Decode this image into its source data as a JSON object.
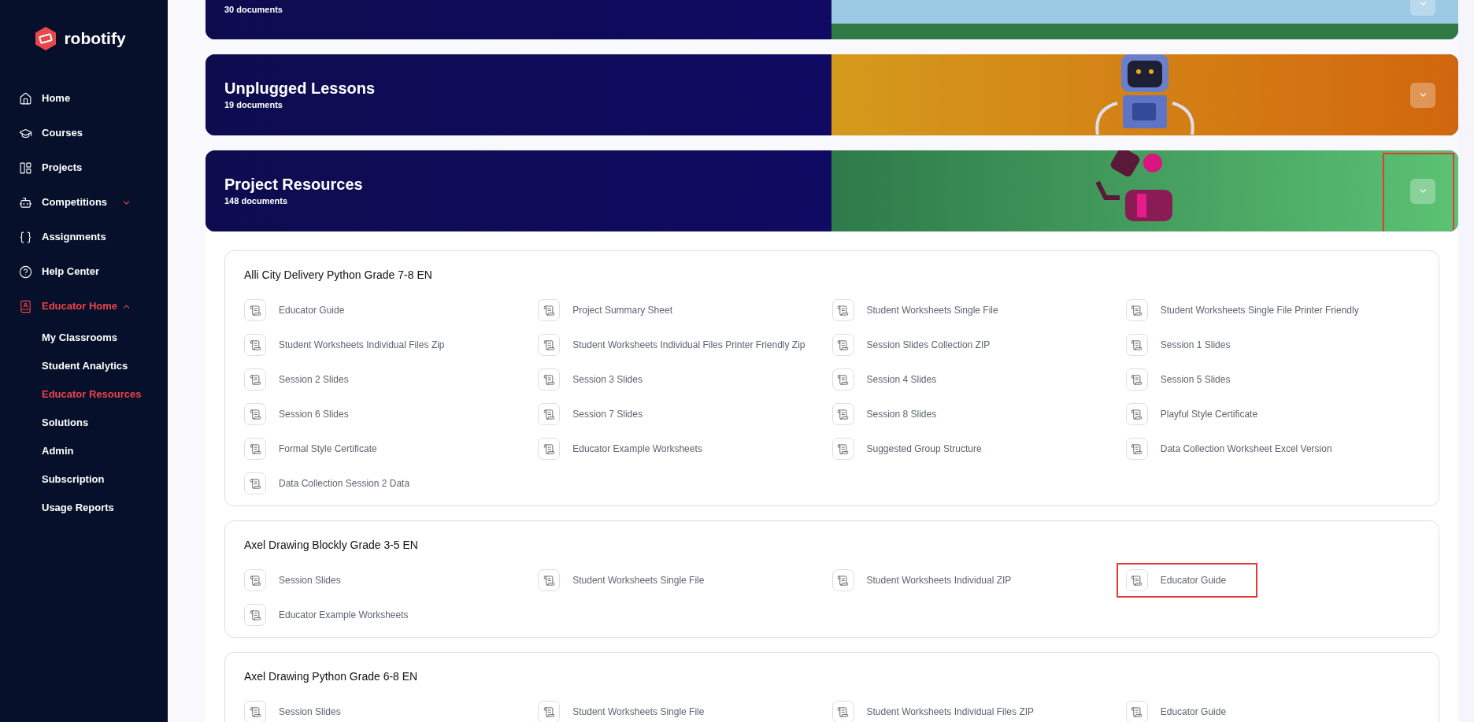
{
  "sidebar": {
    "logo": "robotify",
    "items": [
      {
        "label": "Home",
        "selected": false
      },
      {
        "label": "Courses",
        "selected": false
      },
      {
        "label": "Projects",
        "selected": false
      },
      {
        "label": "Competitions",
        "selected": false,
        "expanded": false
      },
      {
        "label": "Assignments",
        "selected": false
      },
      {
        "label": "Help Center",
        "selected": false
      },
      {
        "label": "Educator Home",
        "selected": true,
        "expanded": true,
        "children": [
          {
            "label": "My Classrooms",
            "selected": false
          },
          {
            "label": "Student Analytics",
            "selected": false
          },
          {
            "label": "Educator Resources",
            "selected": true
          },
          {
            "label": "Solutions",
            "selected": false
          },
          {
            "label": "Admin",
            "selected": false
          },
          {
            "label": "Subscription",
            "selected": false
          },
          {
            "label": "Usage Reports",
            "selected": false
          }
        ]
      }
    ]
  },
  "banners": [
    {
      "count": "30 documents",
      "kind": "park",
      "highlighted": false
    },
    {
      "title": "Unplugged Lessons",
      "count": "19 documents",
      "kind": "orange",
      "highlighted": false
    },
    {
      "title": "Project Resources",
      "count": "148 documents",
      "kind": "green",
      "highlighted": true
    }
  ],
  "projects": [
    {
      "title": "Alli City Delivery Python Grade 7-8 EN",
      "items": [
        {
          "label": "Educator Guide",
          "highlighted": false
        },
        {
          "label": "Project Summary Sheet",
          "highlighted": false
        },
        {
          "label": "Student Worksheets Single File",
          "highlighted": false
        },
        {
          "label": "Student Worksheets Single File Printer Friendly",
          "highlighted": false
        },
        {
          "label": "Student Worksheets Individual Files Zip",
          "highlighted": false
        },
        {
          "label": "Student Worksheets Individual Files Printer Friendly Zip",
          "highlighted": false
        },
        {
          "label": "Session Slides Collection ZIP",
          "highlighted": false
        },
        {
          "label": "Session 1 Slides",
          "highlighted": false
        },
        {
          "label": "Session 2 Slides",
          "highlighted": false
        },
        {
          "label": "Session 3 Slides",
          "highlighted": false
        },
        {
          "label": "Session 4 Slides",
          "highlighted": false
        },
        {
          "label": "Session 5 Slides",
          "highlighted": false
        },
        {
          "label": "Session 6 Slides",
          "highlighted": false
        },
        {
          "label": "Session 7 Slides",
          "highlighted": false
        },
        {
          "label": "Session 8 Slides",
          "highlighted": false
        },
        {
          "label": "Playful Style Certificate",
          "highlighted": false
        },
        {
          "label": "Formal Style Certificate",
          "highlighted": false
        },
        {
          "label": "Educator Example Worksheets",
          "highlighted": false
        },
        {
          "label": "Suggested Group Structure",
          "highlighted": false
        },
        {
          "label": "Data Collection Worksheet Excel Version",
          "highlighted": false
        },
        {
          "label": "Data Collection Session 2 Data",
          "highlighted": false
        }
      ]
    },
    {
      "title": "Axel Drawing Blockly Grade 3-5 EN",
      "items": [
        {
          "label": "Session Slides",
          "highlighted": false
        },
        {
          "label": "Student Worksheets Single File",
          "highlighted": false
        },
        {
          "label": "Student Worksheets Individual ZIP",
          "highlighted": false
        },
        {
          "label": "Educator Guide",
          "highlighted": true
        },
        {
          "label": "Educator Example Worksheets",
          "highlighted": false
        }
      ]
    },
    {
      "title": "Axel Drawing Python Grade 6-8 EN",
      "items": [
        {
          "label": "Session Slides",
          "highlighted": false
        },
        {
          "label": "Student Worksheets Single File",
          "highlighted": false
        },
        {
          "label": "Student Worksheets Individual Files ZIP",
          "highlighted": false
        },
        {
          "label": "Educator Guide",
          "highlighted": false
        }
      ]
    }
  ]
}
